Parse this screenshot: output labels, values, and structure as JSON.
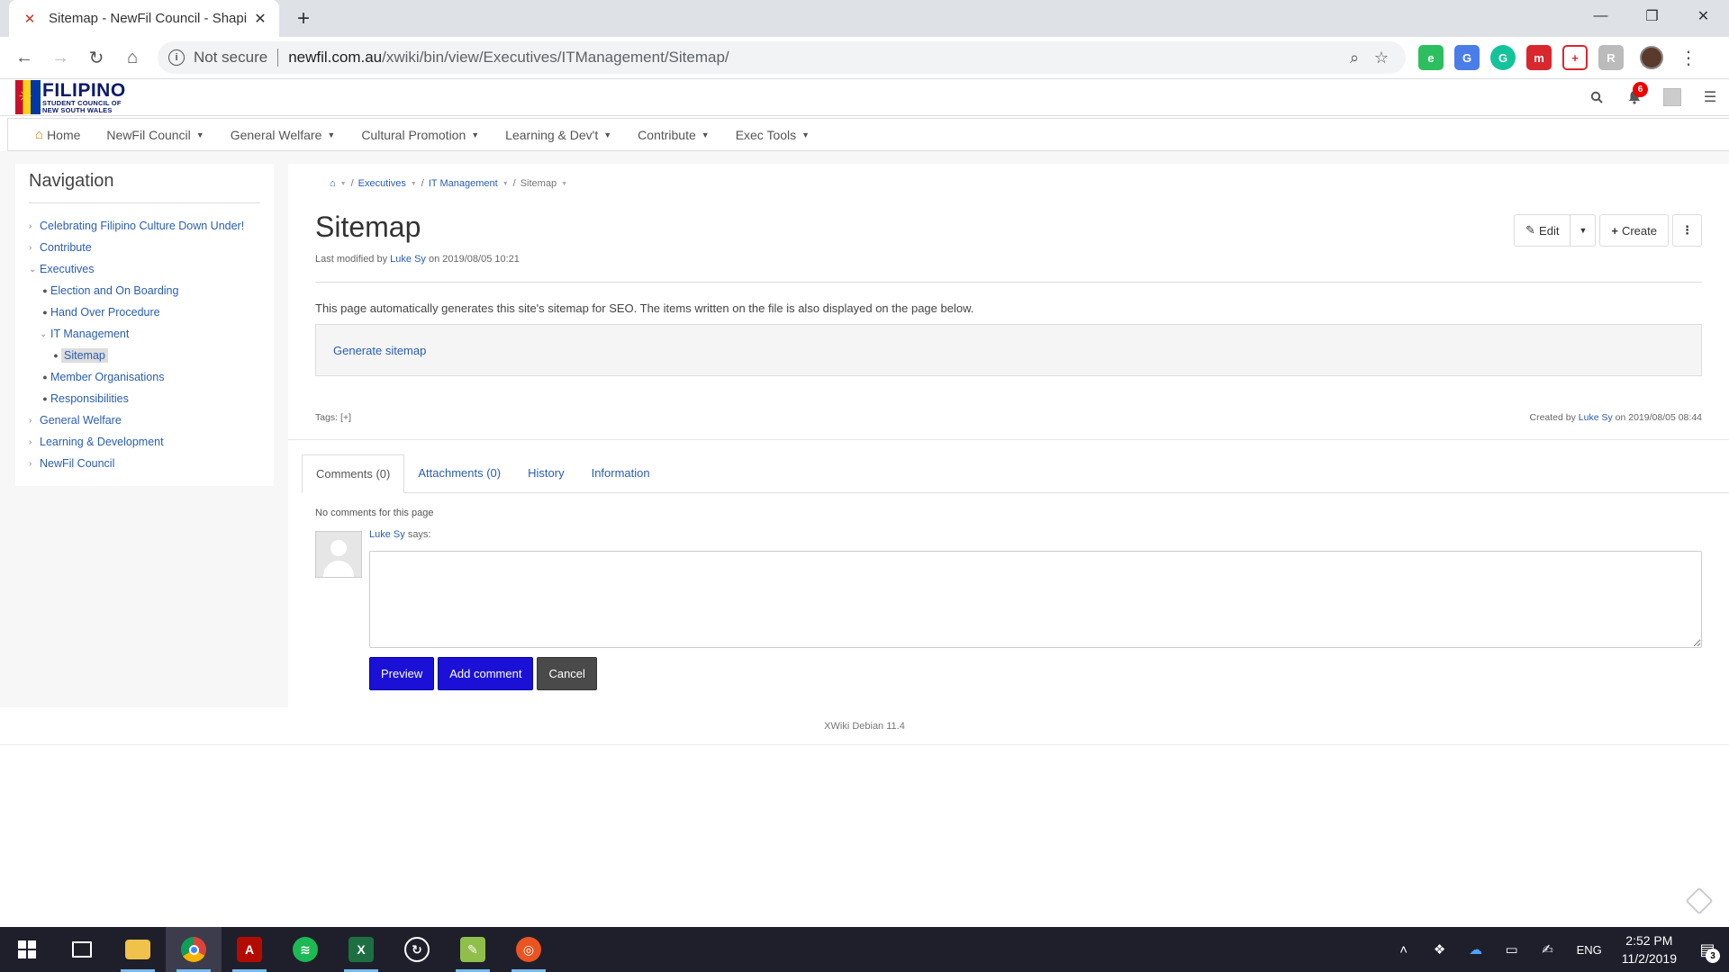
{
  "browser": {
    "tab_title": "Sitemap - NewFil Council - Shapi",
    "omnibox_security": "Not secure",
    "url_host": "newfil.com.au",
    "url_path": "/xwiki/bin/view/Executives/ITManagement/Sitemap/"
  },
  "header": {
    "logo_main": "FILIPINO",
    "logo_sub1": "STUDENT COUNCIL OF",
    "logo_sub2": "NEW SOUTH WALES",
    "notification_count": "6"
  },
  "menu": {
    "home": "Home",
    "items": [
      "NewFil Council",
      "General Welfare",
      "Cultural Promotion",
      "Learning & Dev't",
      "Contribute",
      "Exec Tools"
    ]
  },
  "navigation": {
    "title": "Navigation",
    "items": [
      {
        "label": "Celebrating Filipino Culture Down Under!"
      },
      {
        "label": "Contribute"
      },
      {
        "label": "Executives"
      },
      {
        "label": "Election and On Boarding"
      },
      {
        "label": "Hand Over Procedure"
      },
      {
        "label": "IT Management"
      },
      {
        "label": "Sitemap"
      },
      {
        "label": "Member Organisations"
      },
      {
        "label": "Responsibilities"
      },
      {
        "label": "General Welfare"
      },
      {
        "label": "Learning & Development"
      },
      {
        "label": "NewFil Council"
      }
    ]
  },
  "breadcrumb": [
    "Executives",
    "IT Management",
    "Sitemap"
  ],
  "page": {
    "title": "Sitemap",
    "modified_prefix": "Last modified by",
    "modified_user": "Luke Sy",
    "modified_suffix": "on 2019/08/05 10:21",
    "edit_label": "Edit",
    "create_label": "Create",
    "description": "This page automatically generates this site's sitemap for SEO. The items written on the file is also displayed on the page below.",
    "generate_link": "Generate sitemap",
    "tags_label": "Tags:",
    "tags_add": "[+]",
    "created_prefix": "Created by",
    "created_user": "Luke Sy",
    "created_suffix": "on 2019/08/05 08:44"
  },
  "doc_tabs": [
    "Comments (0)",
    "Attachments (0)",
    "History",
    "Information"
  ],
  "comments": {
    "empty_text": "No comments for this page",
    "author": "Luke Sy",
    "says": "says:",
    "preview_label": "Preview",
    "add_label": "Add comment",
    "cancel_label": "Cancel"
  },
  "footer": {
    "version": "XWiki Debian 11.4"
  },
  "taskbar": {
    "language": "ENG",
    "time": "2:52 PM",
    "date": "11/2/2019",
    "notification_count": "3"
  },
  "colors": {
    "primary_button": "#1a10d6",
    "link": "#2a5db0",
    "taskbar": "#1f1f2b"
  }
}
